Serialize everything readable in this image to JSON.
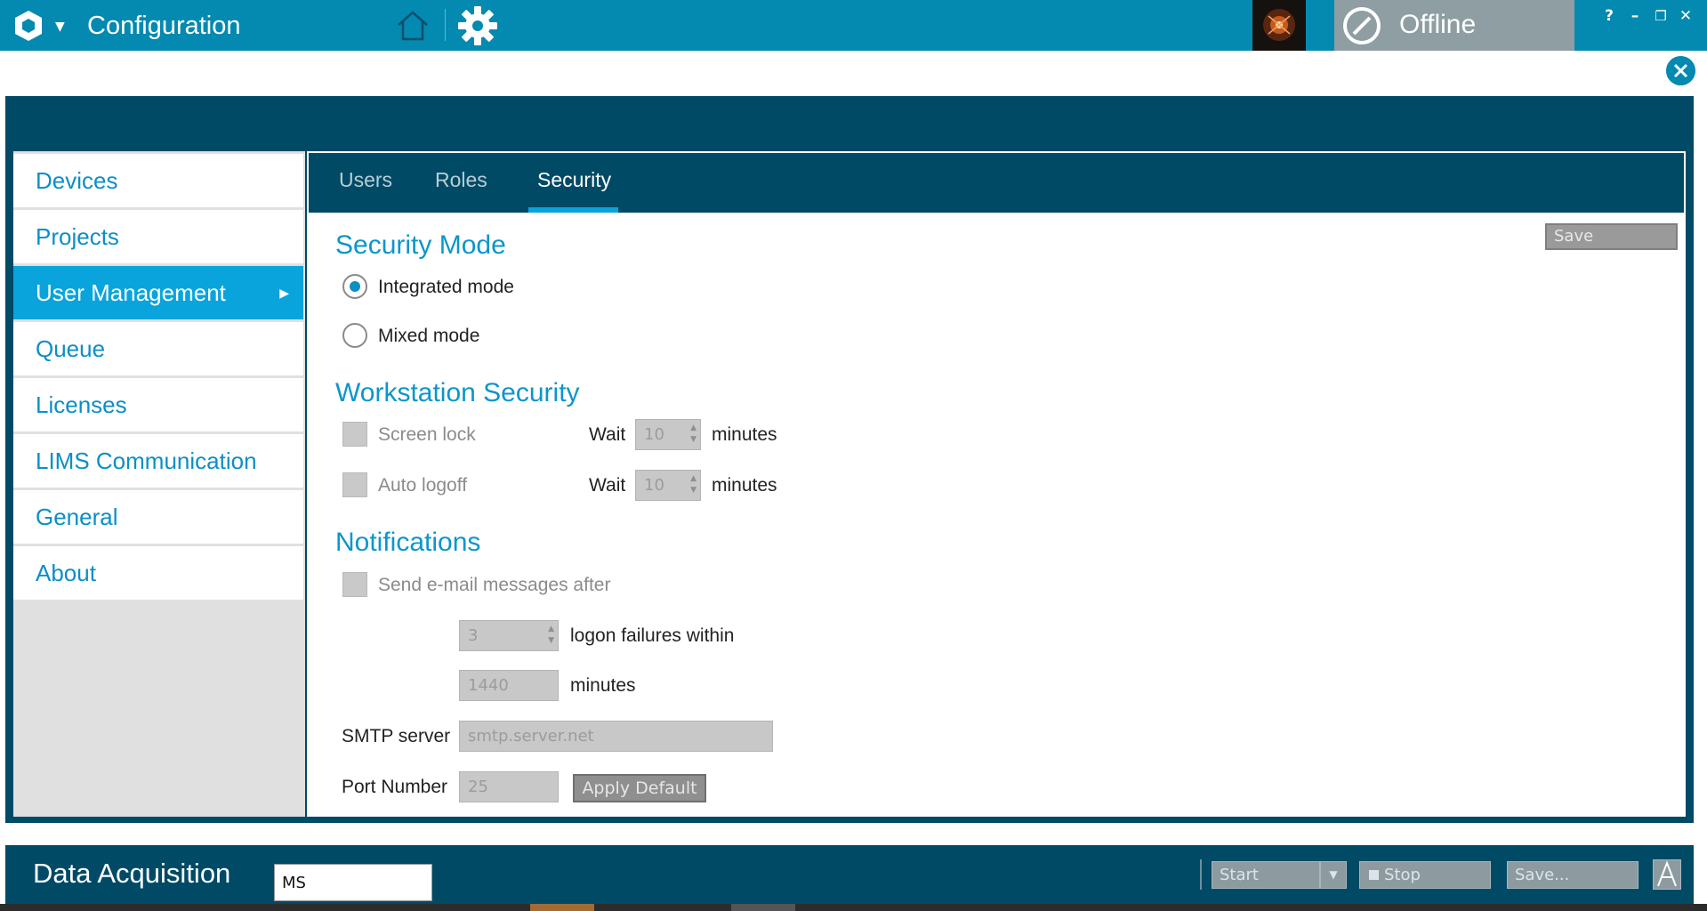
{
  "titlebar": {
    "app_title": "Configuration",
    "status": "Offline",
    "help": "?",
    "minimize": "–",
    "restore": "❐",
    "close": "✕",
    "colors": {
      "bar": "#0489b1",
      "status_pill": "#8e9ea3"
    }
  },
  "sidebar": {
    "items": [
      {
        "label": "Devices"
      },
      {
        "label": "Projects"
      },
      {
        "label": "User Management",
        "active": true
      },
      {
        "label": "Queue"
      },
      {
        "label": "Licenses"
      },
      {
        "label": "LIMS Communication"
      },
      {
        "label": "General"
      },
      {
        "label": "About"
      }
    ],
    "active_color": "#0aa4dc"
  },
  "tabs": [
    {
      "label": "Users"
    },
    {
      "label": "Roles"
    },
    {
      "label": "Security",
      "active": true
    }
  ],
  "security": {
    "save_label": "Save",
    "mode_title": "Security Mode",
    "integrated_label": "Integrated mode",
    "integrated_selected": true,
    "mixed_label": "Mixed mode",
    "workstation_title": "Workstation Security",
    "screen_lock_label": "Screen lock",
    "screen_lock_wait_label": "Wait",
    "screen_lock_value": "10",
    "screen_lock_unit": "minutes",
    "auto_logoff_label": "Auto logoff",
    "auto_logoff_wait_label": "Wait",
    "auto_logoff_value": "10",
    "auto_logoff_unit": "minutes",
    "notifications_title": "Notifications",
    "send_email_label": "Send e-mail messages after",
    "failures_value": "3",
    "failures_label": "logon failures within",
    "within_value": "1440",
    "within_unit": "minutes",
    "smtp_label": "SMTP server",
    "smtp_placeholder": "smtp.server.net",
    "port_label": "Port Number",
    "port_placeholder": "25",
    "apply_default_label": "Apply Default"
  },
  "bottom": {
    "title": "Data Acquisition",
    "ms_value": "MS",
    "start_label": "Start",
    "stop_label": "Stop",
    "save_label": "Save..."
  }
}
